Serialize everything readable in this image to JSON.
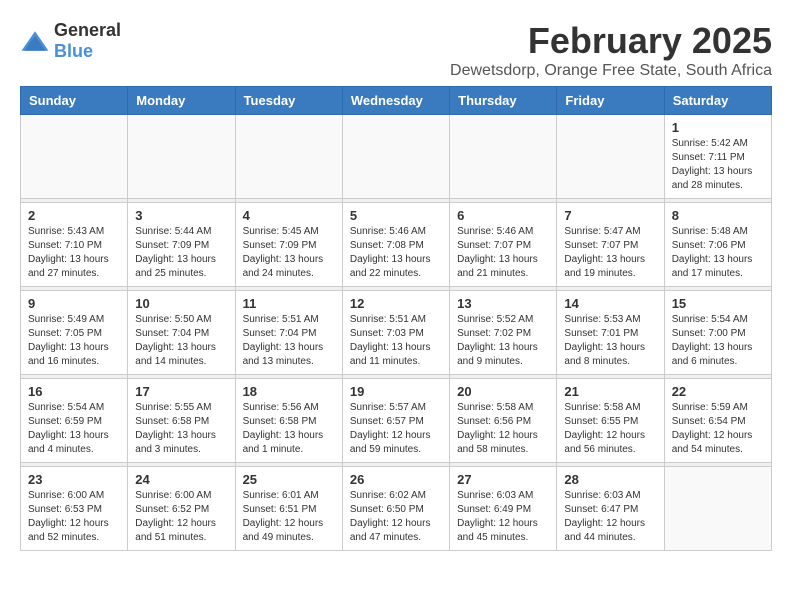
{
  "logo": {
    "general": "General",
    "blue": "Blue"
  },
  "title": "February 2025",
  "location": "Dewetsdorp, Orange Free State, South Africa",
  "days_of_week": [
    "Sunday",
    "Monday",
    "Tuesday",
    "Wednesday",
    "Thursday",
    "Friday",
    "Saturday"
  ],
  "weeks": [
    {
      "days": [
        {
          "number": "",
          "info": ""
        },
        {
          "number": "",
          "info": ""
        },
        {
          "number": "",
          "info": ""
        },
        {
          "number": "",
          "info": ""
        },
        {
          "number": "",
          "info": ""
        },
        {
          "number": "",
          "info": ""
        },
        {
          "number": "1",
          "info": "Sunrise: 5:42 AM\nSunset: 7:11 PM\nDaylight: 13 hours\nand 28 minutes."
        }
      ]
    },
    {
      "days": [
        {
          "number": "2",
          "info": "Sunrise: 5:43 AM\nSunset: 7:10 PM\nDaylight: 13 hours\nand 27 minutes."
        },
        {
          "number": "3",
          "info": "Sunrise: 5:44 AM\nSunset: 7:09 PM\nDaylight: 13 hours\nand 25 minutes."
        },
        {
          "number": "4",
          "info": "Sunrise: 5:45 AM\nSunset: 7:09 PM\nDaylight: 13 hours\nand 24 minutes."
        },
        {
          "number": "5",
          "info": "Sunrise: 5:46 AM\nSunset: 7:08 PM\nDaylight: 13 hours\nand 22 minutes."
        },
        {
          "number": "6",
          "info": "Sunrise: 5:46 AM\nSunset: 7:07 PM\nDaylight: 13 hours\nand 21 minutes."
        },
        {
          "number": "7",
          "info": "Sunrise: 5:47 AM\nSunset: 7:07 PM\nDaylight: 13 hours\nand 19 minutes."
        },
        {
          "number": "8",
          "info": "Sunrise: 5:48 AM\nSunset: 7:06 PM\nDaylight: 13 hours\nand 17 minutes."
        }
      ]
    },
    {
      "days": [
        {
          "number": "9",
          "info": "Sunrise: 5:49 AM\nSunset: 7:05 PM\nDaylight: 13 hours\nand 16 minutes."
        },
        {
          "number": "10",
          "info": "Sunrise: 5:50 AM\nSunset: 7:04 PM\nDaylight: 13 hours\nand 14 minutes."
        },
        {
          "number": "11",
          "info": "Sunrise: 5:51 AM\nSunset: 7:04 PM\nDaylight: 13 hours\nand 13 minutes."
        },
        {
          "number": "12",
          "info": "Sunrise: 5:51 AM\nSunset: 7:03 PM\nDaylight: 13 hours\nand 11 minutes."
        },
        {
          "number": "13",
          "info": "Sunrise: 5:52 AM\nSunset: 7:02 PM\nDaylight: 13 hours\nand 9 minutes."
        },
        {
          "number": "14",
          "info": "Sunrise: 5:53 AM\nSunset: 7:01 PM\nDaylight: 13 hours\nand 8 minutes."
        },
        {
          "number": "15",
          "info": "Sunrise: 5:54 AM\nSunset: 7:00 PM\nDaylight: 13 hours\nand 6 minutes."
        }
      ]
    },
    {
      "days": [
        {
          "number": "16",
          "info": "Sunrise: 5:54 AM\nSunset: 6:59 PM\nDaylight: 13 hours\nand 4 minutes."
        },
        {
          "number": "17",
          "info": "Sunrise: 5:55 AM\nSunset: 6:58 PM\nDaylight: 13 hours\nand 3 minutes."
        },
        {
          "number": "18",
          "info": "Sunrise: 5:56 AM\nSunset: 6:58 PM\nDaylight: 13 hours\nand 1 minute."
        },
        {
          "number": "19",
          "info": "Sunrise: 5:57 AM\nSunset: 6:57 PM\nDaylight: 12 hours\nand 59 minutes."
        },
        {
          "number": "20",
          "info": "Sunrise: 5:58 AM\nSunset: 6:56 PM\nDaylight: 12 hours\nand 58 minutes."
        },
        {
          "number": "21",
          "info": "Sunrise: 5:58 AM\nSunset: 6:55 PM\nDaylight: 12 hours\nand 56 minutes."
        },
        {
          "number": "22",
          "info": "Sunrise: 5:59 AM\nSunset: 6:54 PM\nDaylight: 12 hours\nand 54 minutes."
        }
      ]
    },
    {
      "days": [
        {
          "number": "23",
          "info": "Sunrise: 6:00 AM\nSunset: 6:53 PM\nDaylight: 12 hours\nand 52 minutes."
        },
        {
          "number": "24",
          "info": "Sunrise: 6:00 AM\nSunset: 6:52 PM\nDaylight: 12 hours\nand 51 minutes."
        },
        {
          "number": "25",
          "info": "Sunrise: 6:01 AM\nSunset: 6:51 PM\nDaylight: 12 hours\nand 49 minutes."
        },
        {
          "number": "26",
          "info": "Sunrise: 6:02 AM\nSunset: 6:50 PM\nDaylight: 12 hours\nand 47 minutes."
        },
        {
          "number": "27",
          "info": "Sunrise: 6:03 AM\nSunset: 6:49 PM\nDaylight: 12 hours\nand 45 minutes."
        },
        {
          "number": "28",
          "info": "Sunrise: 6:03 AM\nSunset: 6:47 PM\nDaylight: 12 hours\nand 44 minutes."
        },
        {
          "number": "",
          "info": ""
        }
      ]
    }
  ]
}
